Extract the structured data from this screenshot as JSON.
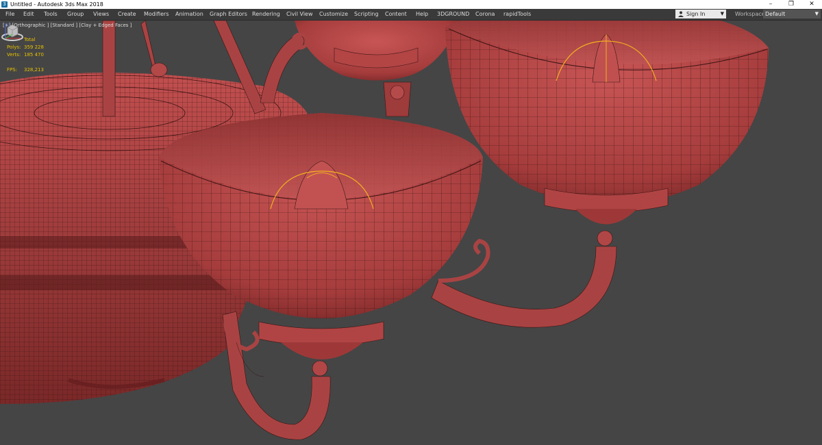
{
  "window": {
    "title": "Untitled - Autodesk 3ds Max 2018",
    "minimize": "–",
    "maximize": "❐",
    "close": "✕"
  },
  "menu": {
    "items": [
      "File",
      "Edit",
      "Tools",
      "Group",
      "Views",
      "Create",
      "Modifiers",
      "Animation",
      "Graph Editors",
      "Rendering",
      "Civil View",
      "Customize",
      "Scripting",
      "Content",
      "Help",
      "3DGROUND",
      "Corona",
      "rapidTools"
    ],
    "sign_in": "Sign In",
    "workspaces_label": "Workspaces:",
    "workspace_value": "Default"
  },
  "viewport": {
    "label": "[+] [Orthographic ] [Standard ] [Clay + Edged Faces ]",
    "stats": {
      "header": "Total",
      "polys_label": "Polys:",
      "polys_value": "359 228",
      "verts_label": "Verts:",
      "verts_value": "185 470",
      "fps_label": "FPS:",
      "fps_value": "328,213"
    }
  },
  "colors": {
    "mesh": "#b84747",
    "wire": "#3b1414",
    "light": "#f0b020",
    "background": "#454545"
  }
}
